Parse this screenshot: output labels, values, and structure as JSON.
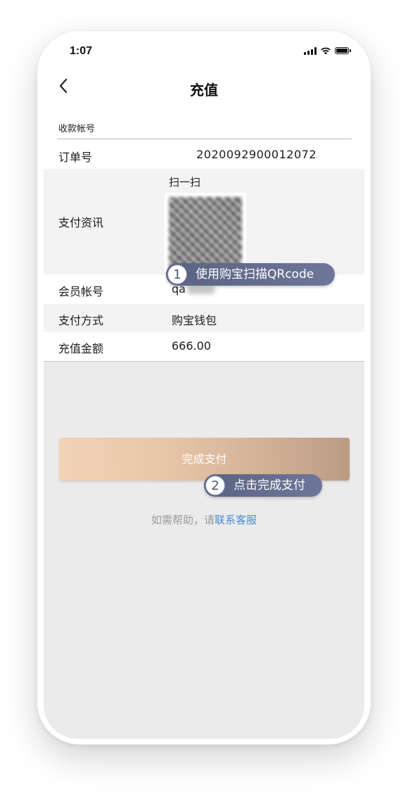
{
  "status": {
    "time": "1:07"
  },
  "header": {
    "title": "充值"
  },
  "rows": {
    "payee_label": "收款帐号",
    "order_label": "订单号",
    "order_value": "2020092900012072",
    "payinfo_label": "支付资讯",
    "scan_label": "扫一扫",
    "member_label": "会员帐号",
    "member_value": "qa",
    "paymethod_label": "支付方式",
    "paymethod_value": "购宝钱包",
    "amount_label": "充值金额",
    "amount_value": "666.00"
  },
  "actions": {
    "pay_button": "完成支付"
  },
  "help": {
    "prefix": "如需帮助，请",
    "link": "联系客服"
  },
  "callouts": [
    {
      "num": "1",
      "text": "使用购宝扫描QRcode"
    },
    {
      "num": "2",
      "text": "点击完成支付"
    }
  ],
  "colors": {
    "link": "#4a8ad6",
    "callout": "#5b6384",
    "button_start": "#f2d2b6",
    "button_end": "#bb9b84"
  }
}
